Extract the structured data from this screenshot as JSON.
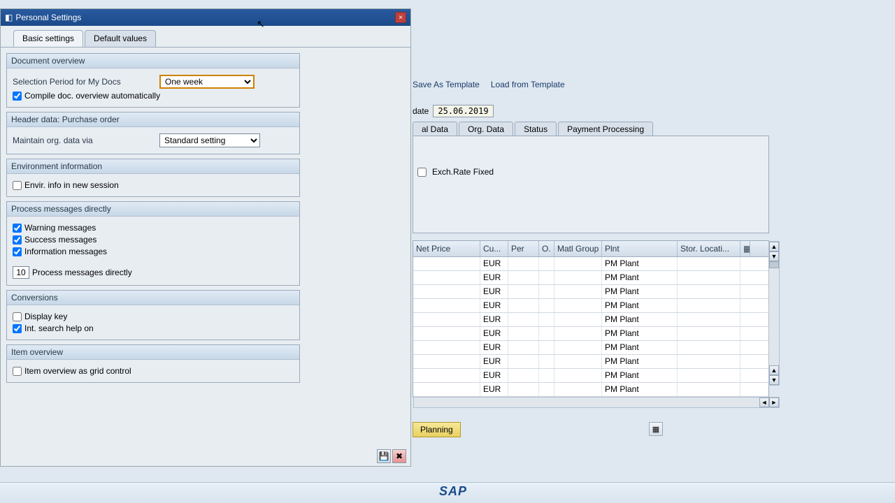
{
  "window_controls": {
    "min": "_",
    "max": "□",
    "close": "×"
  },
  "dialog": {
    "title": "Personal Settings",
    "tabs": [
      {
        "label": "Basic settings",
        "active": true
      },
      {
        "label": "Default values",
        "active": false
      }
    ],
    "groups": {
      "doc_overview": {
        "header": "Document overview",
        "selection_period_label": "Selection Period for My Docs",
        "selection_period_value": "One week",
        "compile_label": "Compile doc. overview automatically",
        "compile_checked": true
      },
      "header_data": {
        "header": "Header data: Purchase order",
        "maintain_label": "Maintain org. data via",
        "maintain_value": "Standard setting"
      },
      "env": {
        "header": "Environment information",
        "new_session_label": "Envir. info in new session",
        "new_session_checked": false
      },
      "process_msgs": {
        "header": "Process messages directly",
        "warning_label": "Warning messages",
        "warning_checked": true,
        "success_label": "Success messages",
        "success_checked": true,
        "info_label": "Information messages",
        "info_checked": true,
        "count_value": "10",
        "count_label": "Process messages directly"
      },
      "conversions": {
        "header": "Conversions",
        "display_key_label": "Display key",
        "display_key_checked": false,
        "int_search_label": "Int. search help on",
        "int_search_checked": true
      },
      "item_overview": {
        "header": "Item overview",
        "grid_label": "Item overview as grid control",
        "grid_checked": false
      }
    }
  },
  "background": {
    "toolbar": {
      "save_template": "Save As Template",
      "load_template": "Load from Template"
    },
    "date_label": "date",
    "date_value": "25.06.2019",
    "tabs": [
      {
        "label": "al Data"
      },
      {
        "label": "Org. Data"
      },
      {
        "label": "Status"
      },
      {
        "label": "Payment Processing"
      }
    ],
    "exch_rate_label": "Exch.Rate Fixed",
    "grid": {
      "columns": [
        "Net Price",
        "Cu...",
        "Per",
        "O.",
        "Matl Group",
        "Plnt",
        "Stor. Locati..."
      ],
      "rows": [
        {
          "cu": "EUR",
          "plnt": "PM Plant"
        },
        {
          "cu": "EUR",
          "plnt": "PM Plant"
        },
        {
          "cu": "EUR",
          "plnt": "PM Plant"
        },
        {
          "cu": "EUR",
          "plnt": "PM Plant"
        },
        {
          "cu": "EUR",
          "plnt": "PM Plant"
        },
        {
          "cu": "EUR",
          "plnt": "PM Plant"
        },
        {
          "cu": "EUR",
          "plnt": "PM Plant"
        },
        {
          "cu": "EUR",
          "plnt": "PM Plant"
        },
        {
          "cu": "EUR",
          "plnt": "PM Plant"
        },
        {
          "cu": "EUR",
          "plnt": "PM Plant"
        }
      ]
    },
    "planning_btn": "Planning",
    "sap": "SAP"
  }
}
